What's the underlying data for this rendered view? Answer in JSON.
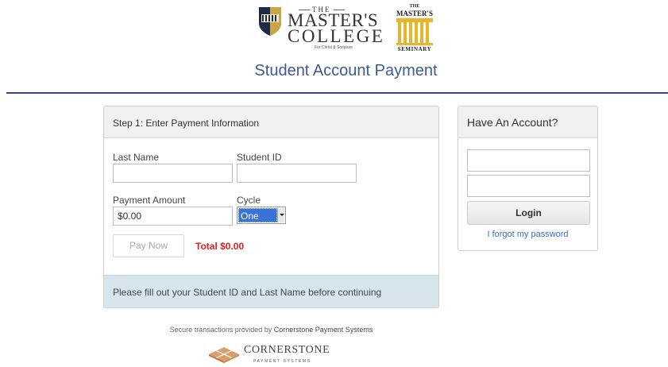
{
  "header": {
    "college_logo": {
      "the": "THE",
      "line1": "MASTER'S",
      "line2": "COLLEGE",
      "tagline": "For Christ & Scripture"
    },
    "seminary_logo": {
      "the": "THE",
      "line1": "MASTER'S",
      "line2": "SEMINARY"
    },
    "title": "Student Account Payment"
  },
  "payment_panel": {
    "heading": "Step 1: Enter Payment Information",
    "last_name_label": "Last Name",
    "last_name_value": "",
    "student_id_label": "Student ID",
    "student_id_value": "",
    "amount_label": "Payment Amount",
    "amount_value": "$0.00",
    "cycle_label": "Cycle",
    "cycle_selected": "One time",
    "pay_button": "Pay Now",
    "total": "Total $0.00",
    "notice": "Please fill out your Student ID and Last Name before continuing"
  },
  "account_panel": {
    "heading": "Have An Account?",
    "username_value": "",
    "password_value": "",
    "login_button": "Login",
    "forgot_link": "I forgot my password"
  },
  "footer": {
    "secure_prefix": "Secure transactions provided by",
    "provider": "Cornerstone Payment Systems",
    "logo_line1": "CORNERSTONE",
    "logo_line2": "PAYMENT SYSTEMS"
  },
  "colors": {
    "title": "#3e5a93",
    "rule": "#2e4a86",
    "total": "#d9231d",
    "notice_bg": "#d7e5ec",
    "link": "#3a6fc0"
  }
}
